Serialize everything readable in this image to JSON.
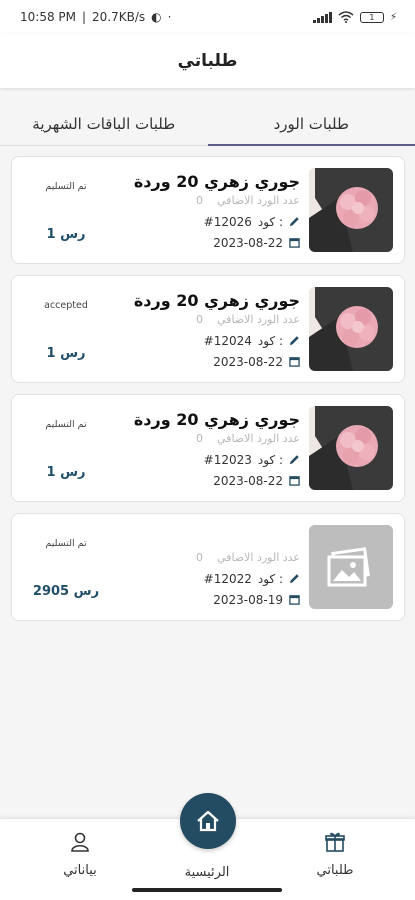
{
  "status_bar": {
    "time": "10:58 PM",
    "speed": "20.7KB/s",
    "battery": "1"
  },
  "header": {
    "title": "طلباتي"
  },
  "tabs": [
    {
      "label": "طلبات الورد",
      "active": true
    },
    {
      "label": "طلبات الباقات الشهرية",
      "active": false
    }
  ],
  "orders": [
    {
      "name": "جوري زهري 20 وردة",
      "extra_label": "عدد الورد الاضافي",
      "extra_count": "0",
      "code_label": "كود :",
      "code": "#12026",
      "date": "2023-08-22",
      "status": "تم التسليم",
      "price": "1 رس",
      "image": "bouquet-photo"
    },
    {
      "name": "جوري زهري 20 وردة",
      "extra_label": "عدد الورد الاضافي",
      "extra_count": "0",
      "code_label": "كود :",
      "code": "#12024",
      "date": "2023-08-22",
      "status": "accepted",
      "price": "1 رس",
      "image": "bouquet-photo"
    },
    {
      "name": "جوري زهري 20 وردة",
      "extra_label": "عدد الورد الاضافي",
      "extra_count": "0",
      "code_label": "كود :",
      "code": "#12023",
      "date": "2023-08-22",
      "status": "تم التسليم",
      "price": "1 رس",
      "image": "bouquet-photo"
    },
    {
      "name": "",
      "extra_label": "عدد الورد الاضافي",
      "extra_count": "0",
      "code_label": "كود :",
      "code": "#12022",
      "date": "2023-08-19",
      "status": "تم التسليم",
      "price": "2905 رس",
      "image": "image-placeholder"
    }
  ],
  "bottom_nav": {
    "orders_label": "طلباتي",
    "home_label": "الرئيسية",
    "profile_label": "بياناتي"
  },
  "colors": {
    "accent": "#234b61",
    "tab_indicator": "#5b5b8e",
    "price": "#1f4f6a"
  }
}
